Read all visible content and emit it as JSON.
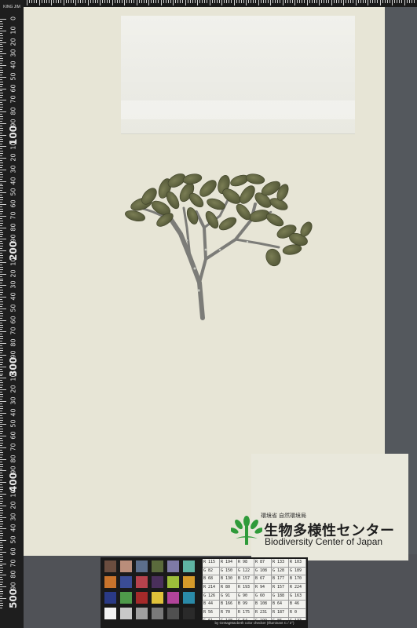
{
  "ruler": {
    "title": "KING JIM",
    "labels": [
      "0",
      "10",
      "20",
      "30",
      "40",
      "50",
      "60",
      "70",
      "80",
      "90",
      "100",
      "10",
      "20",
      "30",
      "40",
      "50",
      "60",
      "70",
      "80",
      "90",
      "200",
      "10",
      "20",
      "30",
      "40",
      "50",
      "60",
      "70",
      "80",
      "90",
      "300",
      "10",
      "20",
      "30",
      "40",
      "50",
      "60",
      "70",
      "80",
      "90",
      "400",
      "10",
      "20",
      "30",
      "40",
      "50",
      "60",
      "70",
      "80",
      "90",
      "500"
    ],
    "big_labels": [
      "100",
      "200",
      "300",
      "400",
      "500"
    ]
  },
  "logo": {
    "org_line": "環境省 自然環境局",
    "name_jp": "生物多様性センター",
    "name_en": "Biodiversity Center of Japan",
    "mark_color": "#2f9a3a"
  },
  "color_card": {
    "swatch_colors": [
      "#6b4d3f",
      "#b98d7a",
      "#5c6e8c",
      "#5a6a3c",
      "#7e7aa6",
      "#5fb4a4",
      "#c8732c",
      "#3a4c95",
      "#b6424d",
      "#4a2f5b",
      "#9cbd3a",
      "#d59a2a",
      "#2a3a86",
      "#4e9a4a",
      "#a52a2a",
      "#e0c23a",
      "#b2449a",
      "#2a8aa8",
      "#f2f2f2",
      "#c8c8c8",
      "#a0a0a0",
      "#7a7a7a",
      "#505050",
      "#2a2a2a"
    ],
    "table": [
      [
        "R 115",
        "R 194",
        "R 98",
        "R 87",
        "R 133",
        "R 103"
      ],
      [
        "G 82",
        "G 150",
        "G 122",
        "G 108",
        "G 128",
        "G 189"
      ],
      [
        "B 68",
        "B 130",
        "B 157",
        "B 67",
        "B 177",
        "B 170"
      ],
      [
        "R 214",
        "R 80",
        "R 193",
        "R 94",
        "R 157",
        "R 224"
      ],
      [
        "G 126",
        "G 91",
        "G 90",
        "G 60",
        "G 188",
        "G 163"
      ],
      [
        "B 44",
        "B 166",
        "B 99",
        "B 108",
        "B 64",
        "B 46"
      ],
      [
        "R 56",
        "R 70",
        "R 175",
        "R 231",
        "R 187",
        "R 0"
      ],
      [
        "G 61",
        "G 148",
        "G 54",
        "G 199",
        "G 86",
        "G 133"
      ],
      [
        "B 150",
        "B 73",
        "B 60",
        "B 31",
        "B 149",
        "B 161"
      ]
    ],
    "caption": "by GretagMacbeth color checker (Illuminant C / 2°)"
  }
}
